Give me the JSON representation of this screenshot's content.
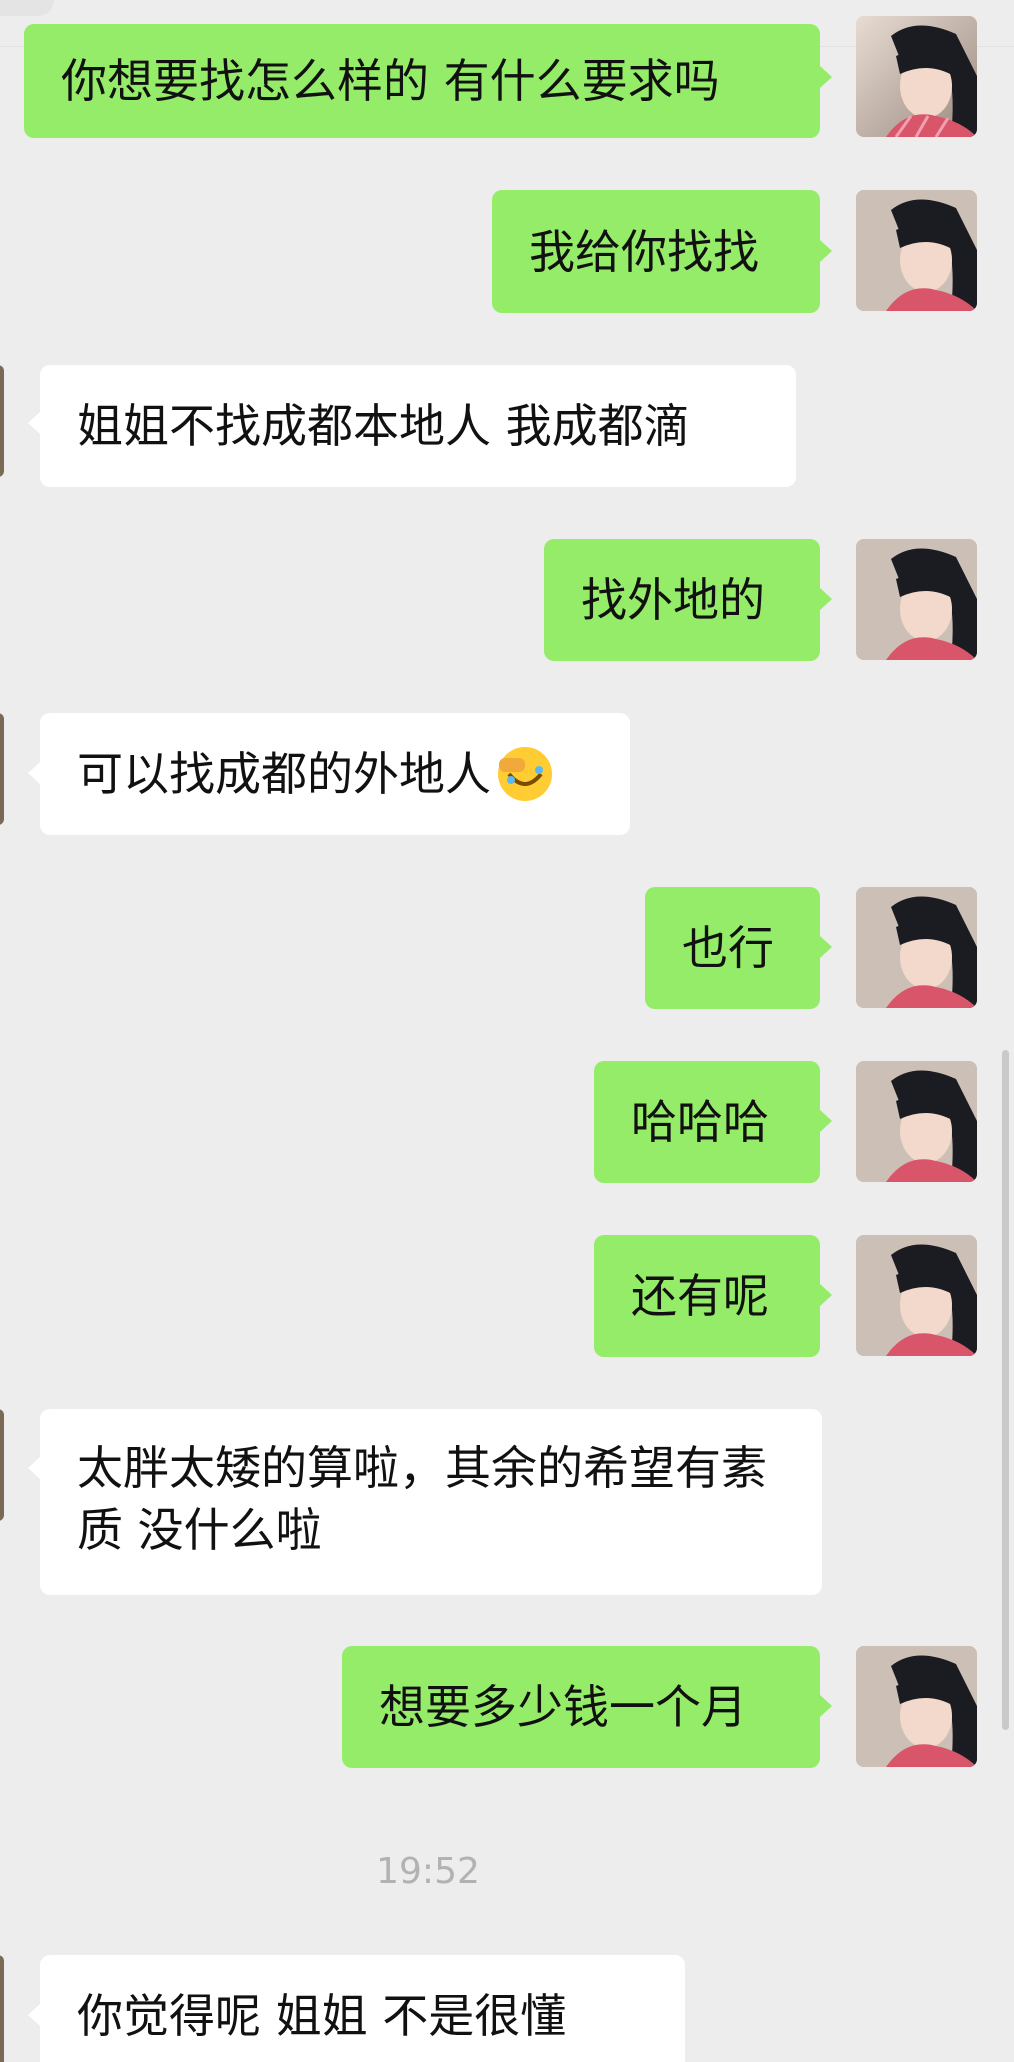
{
  "chat": {
    "messages": [
      {
        "id": "m1",
        "side": "out",
        "text": "你想要找怎么样的 有什么要求吗"
      },
      {
        "id": "m2",
        "side": "out",
        "text": "我给你找找"
      },
      {
        "id": "m3",
        "side": "in",
        "text": "姐姐不找成都本地人 我成都滴"
      },
      {
        "id": "m4",
        "side": "out",
        "text": "找外地的"
      },
      {
        "id": "m5",
        "side": "in",
        "text": "可以找成都的外地人",
        "emoji": "facepalm-emoji"
      },
      {
        "id": "m6",
        "side": "out",
        "text": "也行"
      },
      {
        "id": "m7",
        "side": "out",
        "text": "哈哈哈"
      },
      {
        "id": "m8",
        "side": "out",
        "text": "还有呢"
      },
      {
        "id": "m9",
        "side": "in",
        "text": "太胖太矮的算啦，其余的希望有素质 没什么啦"
      },
      {
        "id": "m10",
        "side": "out",
        "text": "想要多少钱一个月"
      },
      {
        "id": "m11",
        "side": "in",
        "text": "你觉得呢  姐姐 不是很懂"
      }
    ],
    "timestamp": "19:52"
  },
  "colors": {
    "background": "#ededed",
    "outgoing_bubble": "#95ec69",
    "incoming_bubble": "#ffffff",
    "timestamp_text": "#b2b2b2"
  },
  "icons": {
    "self_avatar": "user-avatar",
    "contact_avatar": "contact-avatar",
    "emoji": "facepalm-emoji"
  }
}
